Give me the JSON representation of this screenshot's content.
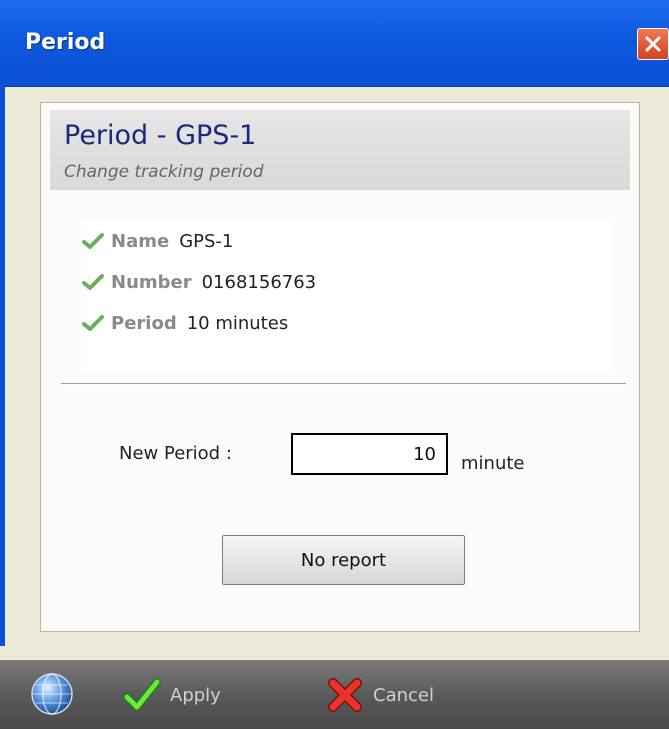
{
  "window": {
    "title": "Period"
  },
  "header": {
    "title": "Period - GPS-1",
    "subtitle": "Change tracking period"
  },
  "info": {
    "rows": [
      {
        "label": "Name",
        "value": "GPS-1"
      },
      {
        "label": "Number",
        "value": "0168156763"
      },
      {
        "label": "Period",
        "value": "10 minutes"
      }
    ]
  },
  "new_period": {
    "label": "New Period :",
    "value": "10",
    "unit": "minute"
  },
  "no_report_label": "No report",
  "toolbar": {
    "apply_label": "Apply",
    "cancel_label": "Cancel"
  },
  "colors": {
    "titlebar": "#0d5ae0",
    "header_title": "#1a2a7a",
    "check": "#6cae5a",
    "toolbar": "#5a5a5a"
  }
}
